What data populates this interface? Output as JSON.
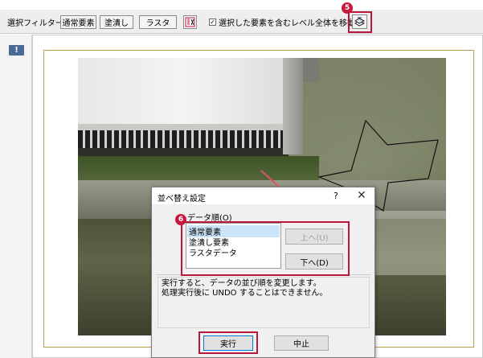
{
  "toolbar": {
    "filter_label": "選択フィルター",
    "normal_button": "通常要素",
    "fill_button": "塗潰し",
    "raster_button": "ラスタ",
    "raster_icon": "raster-order-icon",
    "move_checkbox_label": "選択した要素を含むレベル全体を移動",
    "move_checkbox_checked": true,
    "order_icon": "layer-order-icon"
  },
  "callouts": {
    "step5": "5",
    "step6": "6"
  },
  "sidebar": {
    "info_icon": "!"
  },
  "dialog": {
    "title": "並べ替え設定",
    "help": "?",
    "close": "✕",
    "list_label": "データ順(O)",
    "list_items": [
      "通常要素",
      "塗潰し要素",
      "ラスタデータ"
    ],
    "selected_index": 0,
    "up_button": "上へ(U)",
    "up_disabled": true,
    "down_button": "下へ(D)",
    "message_line1": "実行すると、データの並び順を変更します。",
    "message_line2": "処理実行後に UNDO することはできません。",
    "execute_button": "実行",
    "cancel_button": "中止"
  },
  "colors": {
    "callout_red": "#c8163d",
    "frame_gold": "#b4a24e",
    "selection_blue": "#cce4f7"
  }
}
